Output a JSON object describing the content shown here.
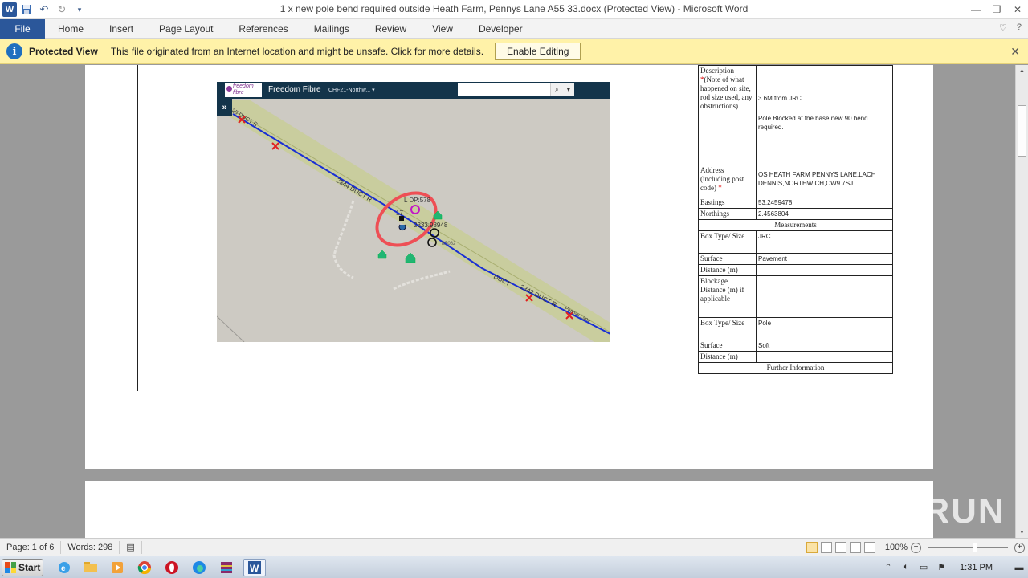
{
  "window": {
    "title": "1 x new pole bend required outside Heath Farm, Pennys Lane A55 33.docx (Protected View)  -  Microsoft Word"
  },
  "ribbon": {
    "tabs": [
      "File",
      "Home",
      "Insert",
      "Page Layout",
      "References",
      "Mailings",
      "Review",
      "View",
      "Developer"
    ]
  },
  "protected_view": {
    "title": "Protected View",
    "message": "This file originated from an Internet location and might be unsafe. Click for more details.",
    "button": "Enable Editing"
  },
  "map": {
    "brand": "Freedom Fibre",
    "logo_text": "freedom fibre",
    "project": "CHF21-Northw...",
    "labels": {
      "duct_top": "2344 DUCT R",
      "duct_left": "25 DUCT R",
      "duct_mid": "DUCT",
      "duct_right": "2342 DUCT R",
      "lane": "Pennys Lane",
      "ldp": "L DP:578",
      "pole": "17",
      "coord": "2333:98948",
      "road": "B5082"
    }
  },
  "table": {
    "description_label": "Description",
    "description_note": "(Note of what happened on site, rod size used, any obstructions)",
    "description_value_1": "3.6M from JRC",
    "description_value_2": "Pole Blocked at the base new 90 bend required.",
    "address_label": "Address (including post code)",
    "address_value": "OS HEATH FARM PENNYS LANE,LACH DENNIS,NORTHWICH,CW9 7SJ",
    "eastings_label": "Eastings",
    "eastings_value": "53.2459478",
    "northings_label": "Northings",
    "northings_value": "2.4563804",
    "measurements_label": "Measurements",
    "box_type_label": "Box Type/ Size",
    "box_type_1": "JRC",
    "surface_label": "Surface",
    "surface_1": "Pavement",
    "distance_label": "Distance (m)",
    "blockage_label": "Blockage Distance (m) if applicable",
    "box_type_2": "Pole",
    "surface_2": "Soft",
    "further_info_label": "Further Information"
  },
  "status": {
    "page": "Page: 1 of 6",
    "words": "Words: 298",
    "zoom": "100%"
  },
  "taskbar": {
    "start": "Start",
    "time": "1:31 PM"
  },
  "watermark": "ANY RUN"
}
